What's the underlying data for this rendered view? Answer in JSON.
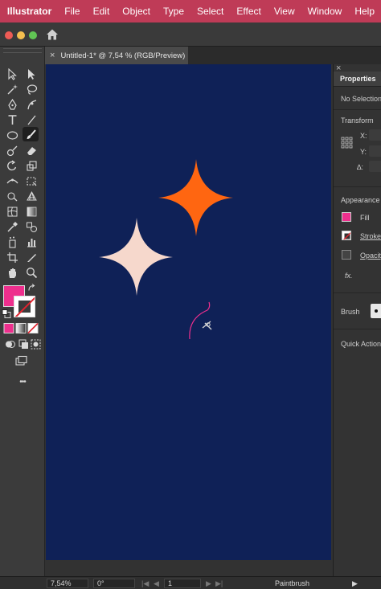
{
  "menubar": {
    "apple_glyph": "",
    "app_name": "Illustrator",
    "items": [
      "File",
      "Edit",
      "Object",
      "Type",
      "Select",
      "Effect",
      "View",
      "Window",
      "Help"
    ]
  },
  "window": {
    "traffic_colors": [
      "#ee5b55",
      "#f4be4f",
      "#61c554"
    ]
  },
  "document": {
    "tab_title": "Untitled-1* @ 7,54 % (RGB/Preview)",
    "close_glyph": "×",
    "artboard_color": "#0f2157"
  },
  "artwork": {
    "large_star_color": "#ff6611",
    "small_star_color": "#f6d8cc",
    "brush_stroke_color": "#ee2f8d"
  },
  "toolbar": {
    "fill_color": "#ee2f8d",
    "stroke_color": "#ffffff",
    "more_glyph": "•••"
  },
  "properties": {
    "close_glyph": "×",
    "tab_label": "Properties",
    "selection": "No Selection",
    "transform_label": "Transform",
    "x_label": "X:",
    "y_label": "Y:",
    "angle_label": "∆:",
    "appearance_label": "Appearance",
    "fill_label": "Fill",
    "stroke_label": "Stroke",
    "opacity_label": "Opacity",
    "fx_label": "fx.",
    "brush_label": "Brush",
    "quick_actions_label": "Quick Actions"
  },
  "status": {
    "zoom": "7,54%",
    "rotation": "0°",
    "artboard_number": "1",
    "current_tool": "Paintbrush"
  }
}
